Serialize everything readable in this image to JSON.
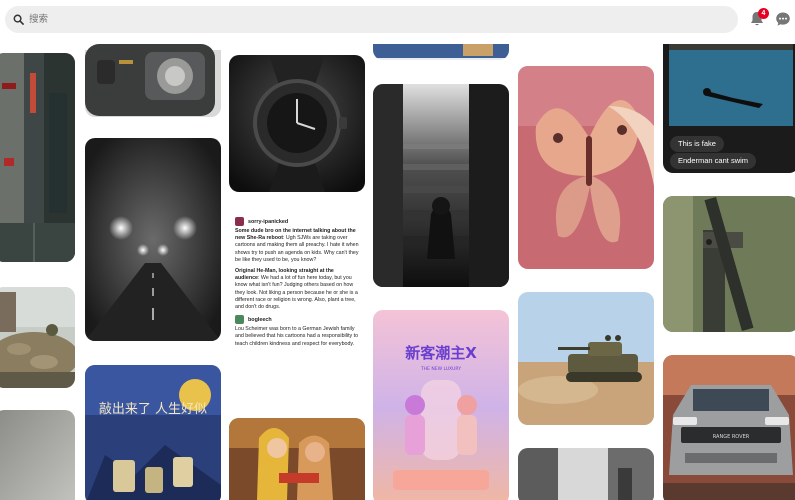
{
  "search": {
    "placeholder": "搜索"
  },
  "header": {
    "notification_count": "4"
  },
  "text_post": {
    "user1": "sorry-ipanicked",
    "p1_bold": "Some dude bro on the internet talking about the new She-Ra reboot",
    "p1_rest": ": Ugh SJWs are taking over cartoons and making them all preachy. I hate it when shows try to push an agenda on kids. Why can't they be like they used to be, you know?",
    "p2_bold": "Original He-Man, looking straight at the audience",
    "p2_rest": ": We had a lot of fun here today, but you know what isn't fun? Judging others based on how they look. Not liking a person because he or she is a different race or religion is wrong. Also, plant a tree, and don't do drugs.",
    "user2": "bogleech",
    "p3": "Lou Scheimer was born to a German Jewish family and believed that his cartoons had a responsibility to teach children kindness and respect for everybody."
  },
  "pool_captions": [
    "This is fake",
    "Enderman cant swim"
  ],
  "poster_title": "新客潮主X",
  "poster_subtitle": "THE NEW LUXURY",
  "car_badge": "RANGE ROVER",
  "calligraphy_text": "敲出来了 人生好似"
}
